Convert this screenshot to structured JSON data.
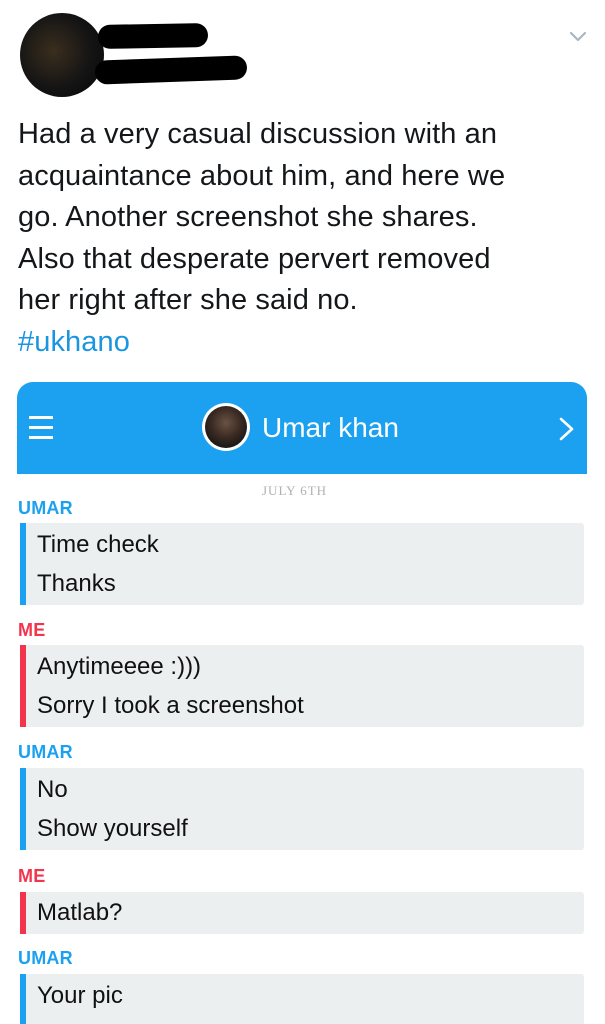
{
  "tweet": {
    "lines": [
      "Had a very casual discussion with an",
      "acquaintance about him, and here we",
      "go. Another screenshot she shares.",
      "Also that desperate pervert removed",
      "her right after she said no."
    ],
    "hashtag": "#ukhano",
    "icons": {
      "menu": "chevron-down-icon"
    },
    "colors": {
      "hashtag": "#1b95e0",
      "text": "#14171a"
    }
  },
  "chat": {
    "contact_name": "Umar khan",
    "date": "JULY 6TH",
    "icons": {
      "menu": "hamburger-menu-icon",
      "forward": "chevron-right-icon"
    },
    "colors": {
      "header": "#1ba1f0",
      "umar": "#1ba1f0",
      "me": "#f2344c",
      "bubble": "#eceff0"
    },
    "groups": [
      {
        "sender": "UMAR",
        "messages": [
          "Time check",
          "Thanks"
        ]
      },
      {
        "sender": "ME",
        "messages": [
          "Anytimeeee :)))",
          "Sorry I took a screenshot"
        ]
      },
      {
        "sender": "UMAR",
        "messages": [
          "No",
          "Show yourself"
        ]
      },
      {
        "sender": "ME",
        "messages": [
          "Matlab?"
        ]
      },
      {
        "sender": "UMAR",
        "messages": [
          "Your pic"
        ]
      }
    ]
  }
}
